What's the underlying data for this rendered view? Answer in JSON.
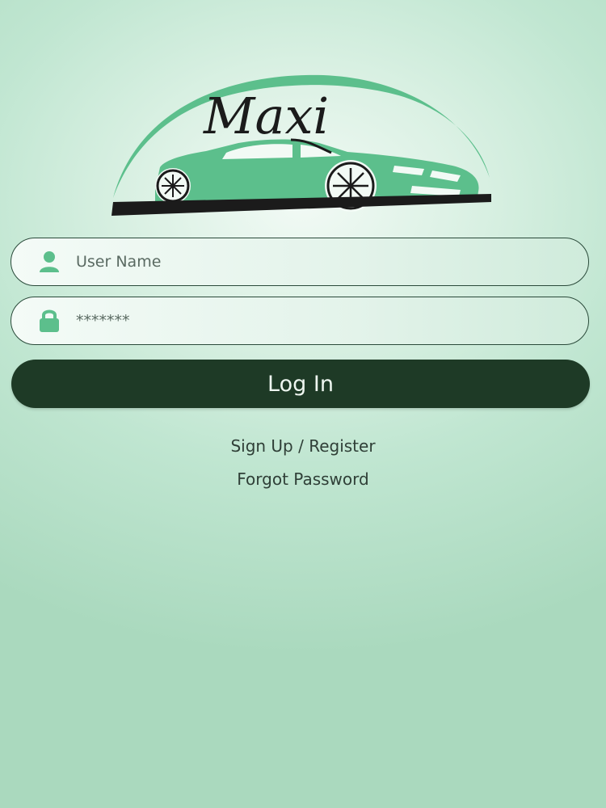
{
  "brand": {
    "logo_text": "Maxi"
  },
  "form": {
    "username": {
      "placeholder": "User Name",
      "icon": "user-icon"
    },
    "password": {
      "placeholder": "*******",
      "icon": "lock-icon"
    },
    "login_label": "Log In"
  },
  "links": {
    "signup": "Sign Up / Register",
    "forgot": "Forgot Password"
  },
  "colors": {
    "accent": "#5cbf8c",
    "button": "#1e3a26",
    "background": "#aad9be"
  }
}
